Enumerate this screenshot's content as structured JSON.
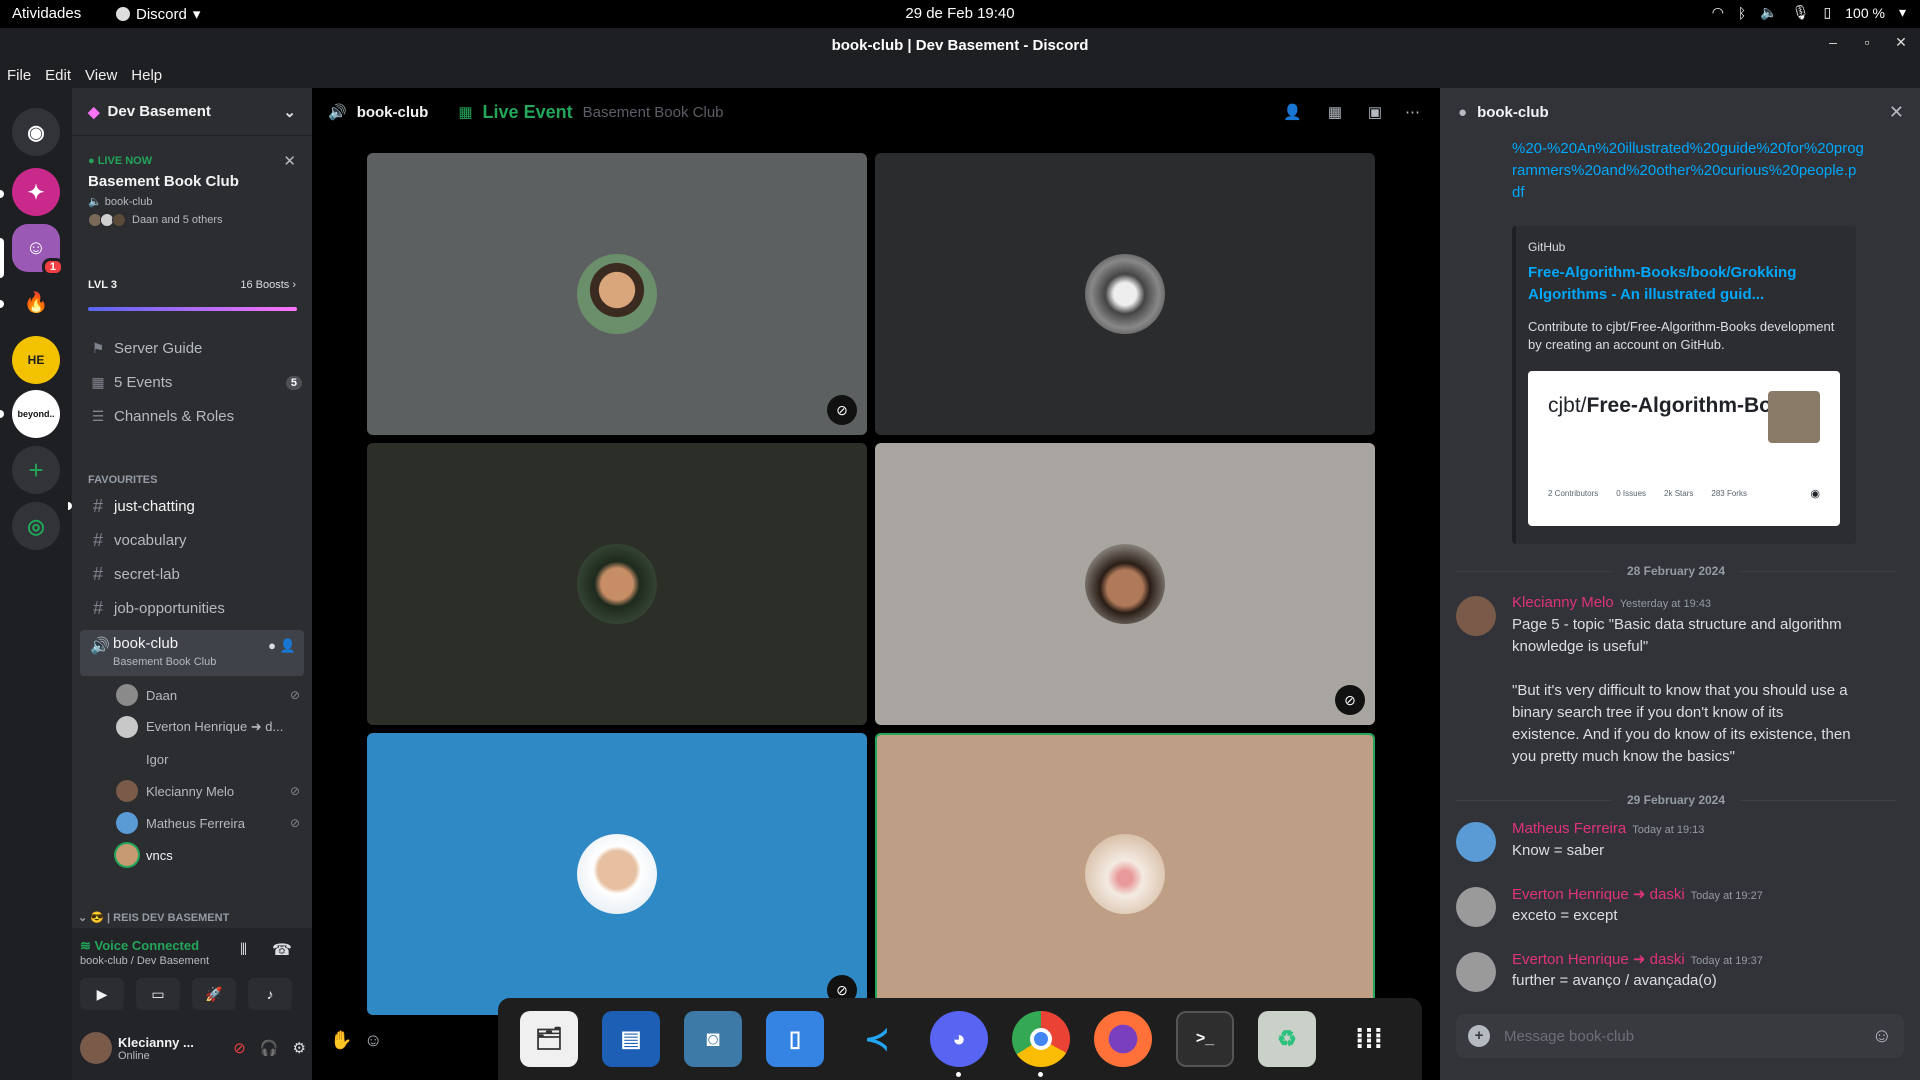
{
  "topbar": {
    "activities": "Atividades",
    "app_name": "Discord",
    "clock": "29 de Feb  19:40",
    "battery": "100 %"
  },
  "window": {
    "title": "book-club | Dev Basement - Discord"
  },
  "menu": {
    "items": [
      "File",
      "Edit",
      "View",
      "Help"
    ]
  },
  "rail": {
    "servers": [
      {
        "icon": "discord-home-icon",
        "color": "#313338"
      },
      {
        "icon": "sparkle-server-icon",
        "color": "#c9298b"
      },
      {
        "icon": "dev-basement-server-icon",
        "color": "#9b59b6",
        "badge": "1"
      },
      {
        "icon": "flame-server-icon",
        "color": "#1e1f22"
      },
      {
        "icon": "hora-extra-server-icon",
        "color": "#f2c200"
      },
      {
        "icon": "beyond-server-icon",
        "color": "#ffffff",
        "label": "beyond.."
      },
      {
        "icon": "add-server-icon",
        "color": "#313338"
      },
      {
        "icon": "explore-icon",
        "color": "#313338"
      }
    ]
  },
  "sidebar": {
    "server_name": "Dev Basement",
    "event": {
      "live_label": "LIVE NOW",
      "title": "Basement Book Club",
      "channel": "book-club",
      "people": "Daan and 5 others"
    },
    "level": "LVL 3",
    "boosts": "16 Boosts",
    "boost_progress": 1.0,
    "nav": [
      {
        "label": "Server Guide",
        "icon": "signpost-icon"
      },
      {
        "label": "5 Events",
        "icon": "calendar-icon",
        "badge": "5"
      },
      {
        "label": "Channels & Roles",
        "icon": "list-search-icon"
      }
    ],
    "category": "FAVOURITES",
    "channels": [
      "just-chatting",
      "vocabulary",
      "secret-lab",
      "job-opportunities"
    ],
    "voice_channel": {
      "name": "book-club",
      "sub": "Basement Book Club"
    },
    "members": [
      {
        "name": "Daan",
        "muted": true
      },
      {
        "name": "Everton Henrique ➜ d...",
        "muted": false
      },
      {
        "name": "Igor",
        "muted": false
      },
      {
        "name": "Klecianny Melo",
        "muted": true
      },
      {
        "name": "Matheus Ferreira",
        "muted": true
      },
      {
        "name": "vncs",
        "muted": false
      }
    ],
    "bottom_category": "😎 | REIS DEV BASEMENT",
    "voice": {
      "status": "Voice Connected",
      "location": "book-club / Dev Basement"
    },
    "user": {
      "name": "Klecianny ...",
      "status": "Online"
    }
  },
  "stage": {
    "channel": "book-club",
    "event_label": "Live Event",
    "event_name": "Basement Book Club"
  },
  "dock": {
    "apps": [
      "files-icon",
      "writer-icon",
      "screenshot-icon",
      "archive-icon",
      "vscode-icon",
      "discord-icon",
      "chrome-icon",
      "firefox-icon",
      "terminal-icon",
      "trash-icon",
      "app-grid-icon"
    ]
  },
  "chat": {
    "channel": "book-club",
    "link_text": "%20-%20An%20illustrated%20guide%20for%20programmers%20and%20other%20curious%20people.pdf",
    "embed": {
      "provider": "GitHub",
      "title": "Free-Algorithm-Books/book/Grokking Algorithms - An illustrated guid...",
      "description": "Contribute to cjbt/Free-Algorithm-Books development by creating an account on GitHub.",
      "card_owner": "cjbt/",
      "card_repo": "Free-Algorithm-Books",
      "stats": [
        "2 Contributors",
        "0 Issues",
        "2k Stars",
        "283 Forks"
      ]
    },
    "dividers": [
      "28 February 2024",
      "29 February 2024"
    ],
    "messages": [
      {
        "author": "Klecianny Melo",
        "time": "Yesterday at 19:43",
        "text": "Page 5 - topic \"Basic data structure and algorithm knowledge is useful\"\n\n\"But it's very difficult to know that you should use a binary search tree if you don't know of its existence. And if you do know of its existence, then you pretty much know the basics\""
      },
      {
        "author": "Matheus Ferreira",
        "time": "Today at 19:13",
        "text": "Know = saber"
      },
      {
        "author": "Everton Henrique ➜ daski",
        "time": "Today at 19:27",
        "text": "exceto = except"
      },
      {
        "author": "Everton Henrique ➜ daski",
        "time": "Today at 19:37",
        "text": "further = avanço / avançada(o)"
      }
    ],
    "input_placeholder": "Message book-club"
  }
}
